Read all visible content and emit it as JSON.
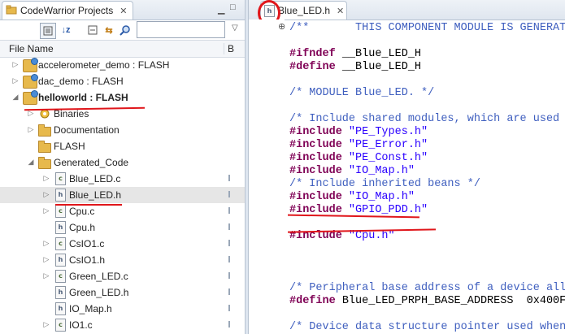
{
  "left_panel": {
    "tab_title": "CodeWarrior Projects",
    "column_name": "File Name",
    "column_second": "B",
    "search_value": ""
  },
  "tree": [
    {
      "label": "accelerometer_demo  :  FLASH",
      "kind": "project",
      "indent": 0,
      "arrow": "closed"
    },
    {
      "label": "dac_demo  :  FLASH",
      "kind": "project",
      "indent": 0,
      "arrow": "closed"
    },
    {
      "label": "helloworld  :  FLASH",
      "kind": "project",
      "indent": 0,
      "arrow": "open",
      "bold": true
    },
    {
      "label": "Binaries",
      "kind": "binaries",
      "indent": 1,
      "arrow": "closed"
    },
    {
      "label": "Documentation",
      "kind": "folder",
      "indent": 1,
      "arrow": "closed"
    },
    {
      "label": "FLASH",
      "kind": "folder",
      "indent": 1,
      "arrow": "none"
    },
    {
      "label": "Generated_Code",
      "kind": "folder",
      "indent": 1,
      "arrow": "open"
    },
    {
      "label": "Blue_LED.c",
      "kind": "c",
      "indent": 2,
      "arrow": "closed"
    },
    {
      "label": "Blue_LED.h",
      "kind": "h",
      "indent": 2,
      "arrow": "closed",
      "selected": true
    },
    {
      "label": "Cpu.c",
      "kind": "c",
      "indent": 2,
      "arrow": "closed"
    },
    {
      "label": "Cpu.h",
      "kind": "h",
      "indent": 2,
      "arrow": "none"
    },
    {
      "label": "CsIO1.c",
      "kind": "c",
      "indent": 2,
      "arrow": "closed"
    },
    {
      "label": "CsIO1.h",
      "kind": "h",
      "indent": 2,
      "arrow": "closed"
    },
    {
      "label": "Green_LED.c",
      "kind": "c",
      "indent": 2,
      "arrow": "closed"
    },
    {
      "label": "Green_LED.h",
      "kind": "h",
      "indent": 2,
      "arrow": "none"
    },
    {
      "label": "IO_Map.h",
      "kind": "h",
      "indent": 2,
      "arrow": "none"
    },
    {
      "label": "IO1.c",
      "kind": "c",
      "indent": 2,
      "arrow": "closed"
    }
  ],
  "editor": {
    "tab_title": "Blue_LED.h",
    "fold_marker": "⊕",
    "lines": [
      {
        "parts": [
          {
            "t": "/**       THIS COMPONENT MODULE IS GENERATED BY",
            "c": "cm"
          }
        ]
      },
      {
        "parts": []
      },
      {
        "parts": [
          {
            "t": "#ifndef",
            "c": "kw"
          },
          {
            "t": " __Blue_LED_H",
            "c": ""
          }
        ]
      },
      {
        "parts": [
          {
            "t": "#define",
            "c": "kw"
          },
          {
            "t": " __Blue_LED_H",
            "c": ""
          }
        ]
      },
      {
        "parts": []
      },
      {
        "parts": [
          {
            "t": "/* MODULE Blue_LED. */",
            "c": "cm"
          }
        ]
      },
      {
        "parts": []
      },
      {
        "parts": [
          {
            "t": "/* Include shared modules, which are used for",
            "c": "cm"
          }
        ]
      },
      {
        "parts": [
          {
            "t": "#include",
            "c": "kw"
          },
          {
            "t": " ",
            "c": ""
          },
          {
            "t": "\"PE_Types.h\"",
            "c": "str"
          }
        ]
      },
      {
        "parts": [
          {
            "t": "#include",
            "c": "kw"
          },
          {
            "t": " ",
            "c": ""
          },
          {
            "t": "\"PE_Error.h\"",
            "c": "str"
          }
        ]
      },
      {
        "parts": [
          {
            "t": "#include",
            "c": "kw"
          },
          {
            "t": " ",
            "c": ""
          },
          {
            "t": "\"PE_Const.h\"",
            "c": "str"
          }
        ]
      },
      {
        "parts": [
          {
            "t": "#include",
            "c": "kw"
          },
          {
            "t": " ",
            "c": ""
          },
          {
            "t": "\"IO_Map.h\"",
            "c": "str"
          }
        ]
      },
      {
        "parts": [
          {
            "t": "/* Include inherited beans */",
            "c": "cm"
          }
        ]
      },
      {
        "parts": [
          {
            "t": "#include",
            "c": "kw"
          },
          {
            "t": " ",
            "c": ""
          },
          {
            "t": "\"IO_Map.h\"",
            "c": "str"
          }
        ]
      },
      {
        "parts": [
          {
            "t": "#include",
            "c": "kw"
          },
          {
            "t": " ",
            "c": ""
          },
          {
            "t": "\"GPIO_PDD.h\"",
            "c": "str"
          }
        ]
      },
      {
        "parts": []
      },
      {
        "parts": [
          {
            "t": "#include",
            "c": "kw"
          },
          {
            "t": " ",
            "c": ""
          },
          {
            "t": "\"Cpu.h\"",
            "c": "str"
          }
        ]
      },
      {
        "parts": []
      },
      {
        "parts": []
      },
      {
        "parts": []
      },
      {
        "parts": [
          {
            "t": "/* Peripheral base address of a device allo",
            "c": "cm"
          }
        ]
      },
      {
        "parts": [
          {
            "t": "#define",
            "c": "kw"
          },
          {
            "t": " Blue_LED_PRPH_BASE_ADDRESS  0x400FF",
            "c": ""
          }
        ]
      },
      {
        "parts": []
      },
      {
        "parts": [
          {
            "t": "/* Device data structure pointer used when",
            "c": "cm"
          }
        ]
      }
    ]
  }
}
